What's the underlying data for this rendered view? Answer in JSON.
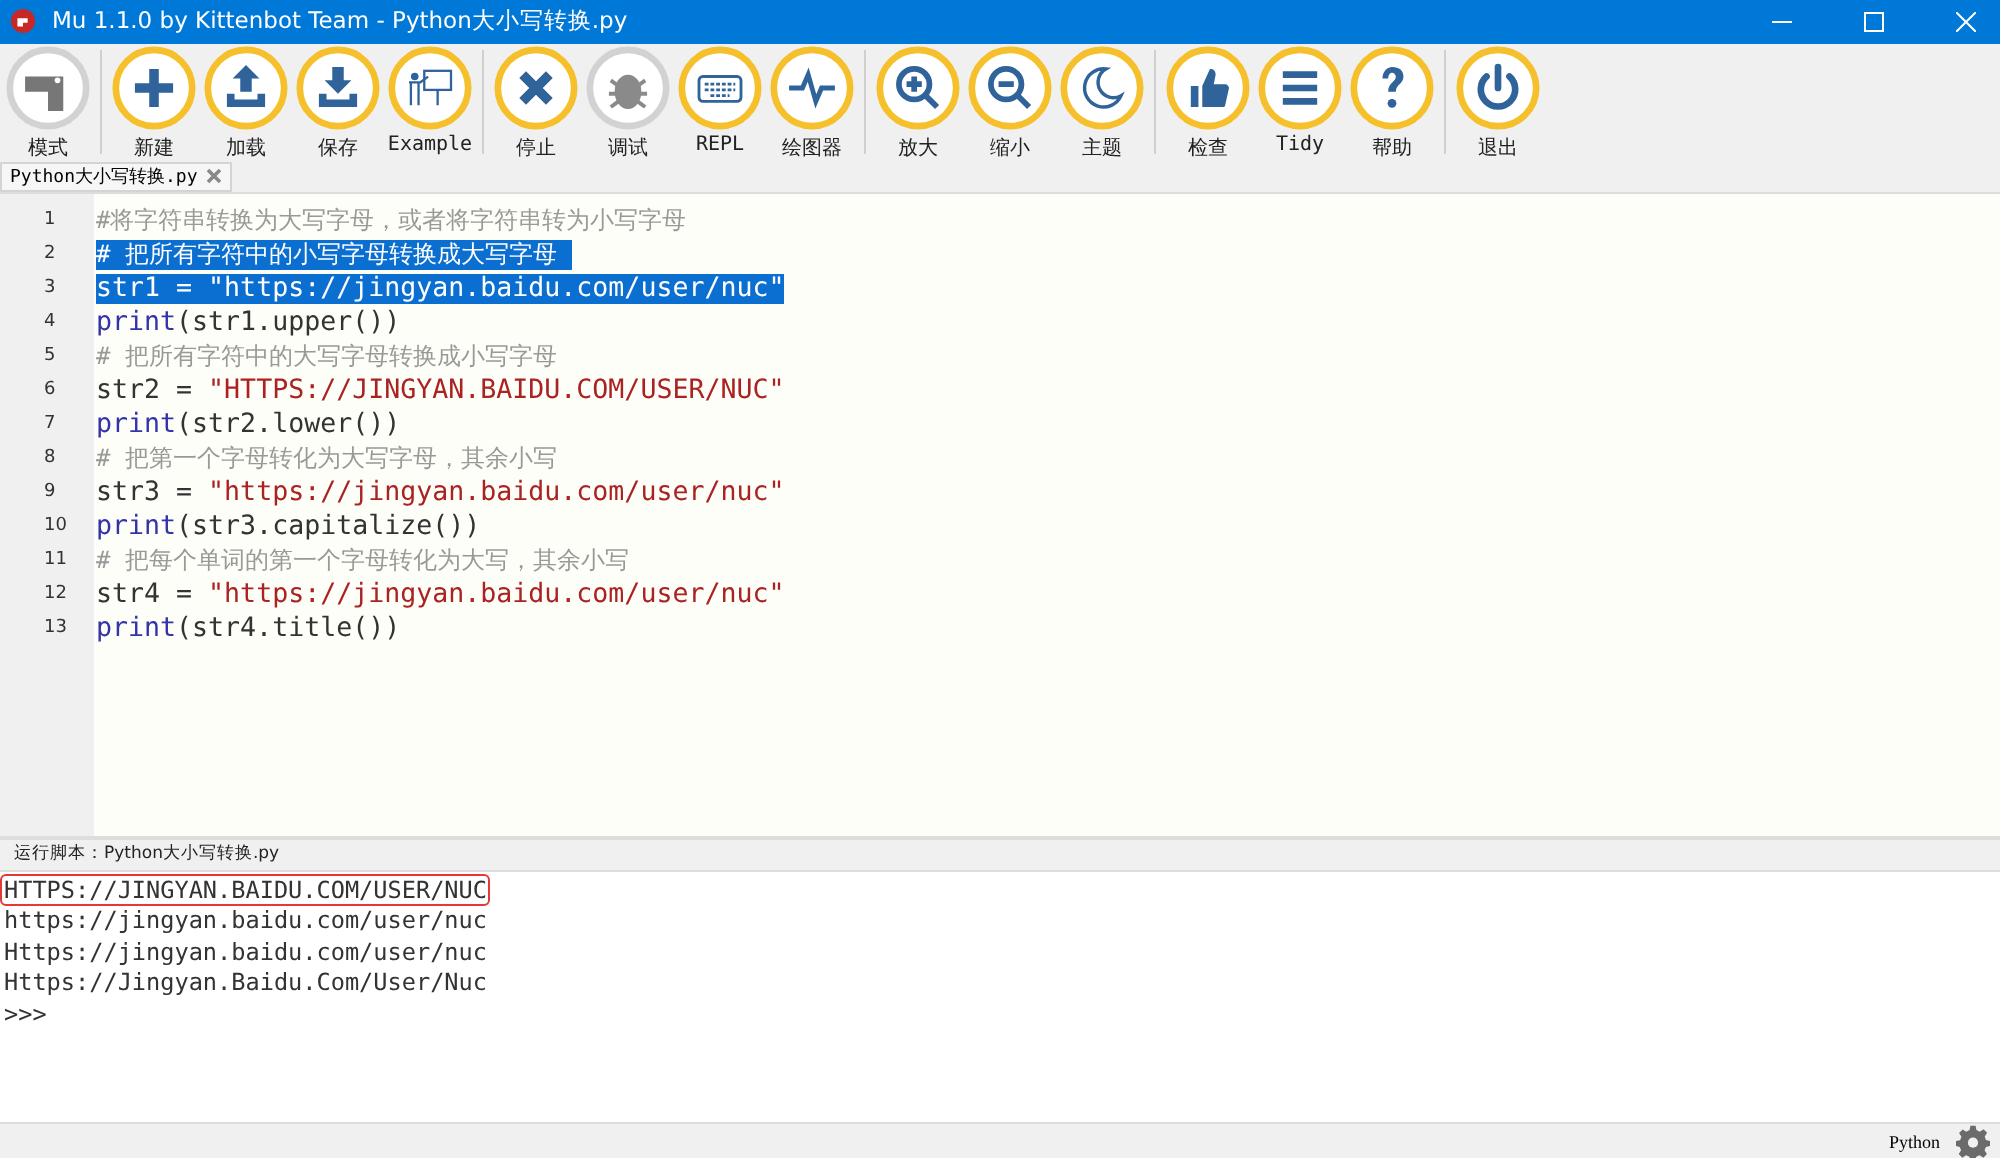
{
  "window": {
    "title": "Mu 1.1.0 by Kittenbot Team - Python大小写转换.py"
  },
  "toolbar": [
    [
      {
        "label": "模式",
        "kind": "mode",
        "disabled": true
      }
    ],
    [
      {
        "label": "新建",
        "kind": "plus",
        "disabled": false
      },
      {
        "label": "加载",
        "kind": "upload",
        "disabled": false
      },
      {
        "label": "保存",
        "kind": "download",
        "disabled": false
      },
      {
        "label": "Example",
        "kind": "teacher",
        "disabled": false
      }
    ],
    [
      {
        "label": "停止",
        "kind": "cross",
        "disabled": false
      },
      {
        "label": "调试",
        "kind": "bug",
        "disabled": true
      },
      {
        "label": "REPL",
        "kind": "keyboard",
        "disabled": false
      },
      {
        "label": "绘图器",
        "kind": "pulse",
        "disabled": false
      }
    ],
    [
      {
        "label": "放大",
        "kind": "zoomin",
        "disabled": false
      },
      {
        "label": "缩小",
        "kind": "zoomout",
        "disabled": false
      },
      {
        "label": "主题",
        "kind": "moon",
        "disabled": false
      }
    ],
    [
      {
        "label": "检查",
        "kind": "thumb",
        "disabled": false
      },
      {
        "label": "Tidy",
        "kind": "lines",
        "disabled": false
      },
      {
        "label": "帮助",
        "kind": "question",
        "disabled": false
      }
    ],
    [
      {
        "label": "退出",
        "kind": "power",
        "disabled": false
      }
    ]
  ],
  "tabs": [
    {
      "label": "Python大小写转换.py",
      "selected": true
    }
  ],
  "editor": {
    "lines": [
      {
        "number": "1",
        "selected": false,
        "tokens": [
          {
            "kind": "comment",
            "text": "#将字符串转换为大写字母，或者将字符串转为小写字母"
          }
        ]
      },
      {
        "number": "2",
        "selected": true,
        "tokens": [
          {
            "kind": "comment",
            "text": "# 把所有字符中的小写字母转换成大写字母 "
          }
        ]
      },
      {
        "number": "3",
        "selected": true,
        "tokens": [
          {
            "kind": "name",
            "text": "str1 = "
          },
          {
            "kind": "string",
            "text": "\"https://jingyan.baidu.com/user/nuc\""
          }
        ]
      },
      {
        "number": "4",
        "selected": false,
        "tokens": [
          {
            "kind": "keyword",
            "text": "print"
          },
          {
            "kind": "name",
            "text": "(str1.upper())"
          }
        ]
      },
      {
        "number": "5",
        "selected": false,
        "tokens": [
          {
            "kind": "comment",
            "text": "# 把所有字符中的大写字母转换成小写字母"
          }
        ]
      },
      {
        "number": "6",
        "selected": false,
        "tokens": [
          {
            "kind": "name",
            "text": "str2 = "
          },
          {
            "kind": "string",
            "text": "\"HTTPS://JINGYAN.BAIDU.COM/USER/NUC\""
          }
        ]
      },
      {
        "number": "7",
        "selected": false,
        "tokens": [
          {
            "kind": "keyword",
            "text": "print"
          },
          {
            "kind": "name",
            "text": "(str2.lower())"
          }
        ]
      },
      {
        "number": "8",
        "selected": false,
        "tokens": [
          {
            "kind": "comment",
            "text": "# 把第一个字母转化为大写字母，其余小写"
          }
        ]
      },
      {
        "number": "9",
        "selected": false,
        "tokens": [
          {
            "kind": "name",
            "text": "str3 = "
          },
          {
            "kind": "string",
            "text": "\"https://jingyan.baidu.com/user/nuc\""
          }
        ]
      },
      {
        "number": "10",
        "selected": false,
        "tokens": [
          {
            "kind": "keyword",
            "text": "print"
          },
          {
            "kind": "name",
            "text": "(str3.capitalize())"
          }
        ]
      },
      {
        "number": "11",
        "selected": false,
        "tokens": [
          {
            "kind": "comment",
            "text": "# 把每个单词的第一个字母转化为大写，其余小写"
          }
        ]
      },
      {
        "number": "12",
        "selected": false,
        "tokens": [
          {
            "kind": "name",
            "text": "str4 = "
          },
          {
            "kind": "string",
            "text": "\"https://jingyan.baidu.com/user/nuc\""
          }
        ]
      },
      {
        "number": "13",
        "selected": false,
        "tokens": [
          {
            "kind": "keyword",
            "text": "print"
          },
          {
            "kind": "name",
            "text": "(str4.title())"
          }
        ]
      }
    ]
  },
  "runner": {
    "title": "运行脚本：Python大小写转换.py",
    "output": [
      {
        "text": "HTTPS://JINGYAN.BAIDU.COM/USER/NUC",
        "highlighted": true
      },
      {
        "text": "https://jingyan.baidu.com/user/nuc",
        "highlighted": false
      },
      {
        "text": "Https://jingyan.baidu.com/user/nuc",
        "highlighted": false
      },
      {
        "text": "Https://Jingyan.Baidu.Com/User/Nuc",
        "highlighted": false
      },
      {
        "text": ">>>",
        "highlighted": false
      }
    ]
  },
  "status_bar": {
    "mode": "Python"
  }
}
